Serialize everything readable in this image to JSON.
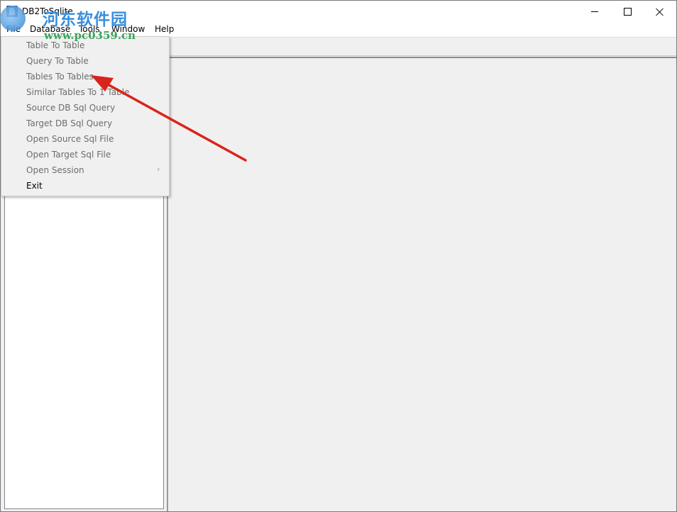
{
  "window": {
    "title": "DB2ToSqlite"
  },
  "menubar": {
    "items": [
      "File",
      "Database",
      "Tools",
      "Window",
      "Help"
    ]
  },
  "file_menu": {
    "items": [
      {
        "label": "Table To Table",
        "enabled": false
      },
      {
        "label": "Query To Table",
        "enabled": false
      },
      {
        "label": "Tables To Tables",
        "enabled": false
      },
      {
        "label": "Similar Tables To 1 Table",
        "enabled": false
      },
      {
        "label": "Source DB Sql Query",
        "enabled": false
      },
      {
        "label": "Target DB Sql Query",
        "enabled": false
      },
      {
        "label": "Open Source Sql File",
        "enabled": false
      },
      {
        "label": "Open Target Sql File",
        "enabled": false
      },
      {
        "label": "Open Session",
        "enabled": false,
        "has_submenu": true
      },
      {
        "label": "Exit",
        "enabled": true
      }
    ],
    "submenu_glyph": "›"
  },
  "watermark": {
    "site_name": "河东软件园",
    "url": "www.pc0359.cn"
  },
  "annotation": {
    "arrow_color": "#d9241b"
  }
}
